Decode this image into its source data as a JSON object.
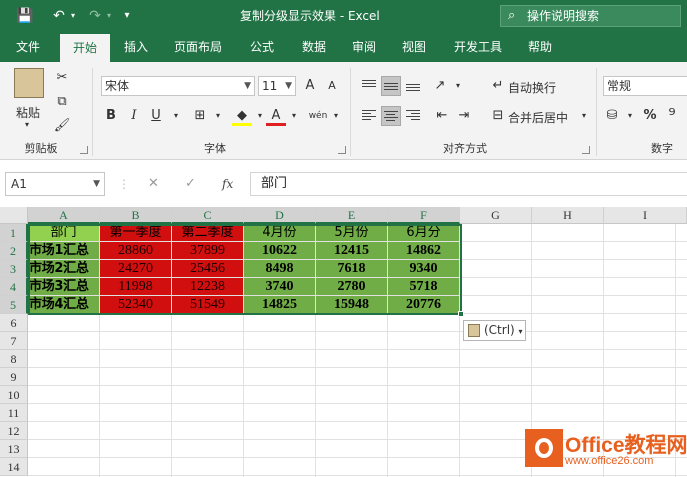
{
  "titlebar": {
    "title": "复制分级显示效果  -  Excel",
    "tell_me": "操作说明搜索"
  },
  "tabs": [
    "文件",
    "开始",
    "插入",
    "页面布局",
    "公式",
    "数据",
    "审阅",
    "视图",
    "开发工具",
    "帮助"
  ],
  "active_tab": "开始",
  "ribbon": {
    "clipboard": {
      "paste": "粘贴",
      "label": "剪贴板"
    },
    "font": {
      "name": "宋体",
      "size": "11",
      "bold": "B",
      "italic": "I",
      "underline": "U",
      "grow": "A",
      "shrink": "A",
      "color_letter": "A",
      "wen": "wén",
      "label": "字体"
    },
    "alignment": {
      "wrap": "自动换行",
      "merge": "合并后居中",
      "label": "对齐方式"
    },
    "number": {
      "format": "常规",
      "percent": "%",
      "label": "数字"
    }
  },
  "formula_bar": {
    "name_box": "A1",
    "fx": "fx",
    "content": "部门"
  },
  "grid": {
    "columns": [
      "A",
      "B",
      "C",
      "D",
      "E",
      "F",
      "G",
      "H",
      "I"
    ],
    "rows": [
      "1",
      "2",
      "3",
      "4",
      "5",
      "6",
      "7",
      "8",
      "9",
      "10",
      "11",
      "12",
      "13",
      "14"
    ],
    "data": [
      [
        "部门",
        "第一季度",
        "第二季度",
        "4月份",
        "5月份",
        "6月分"
      ],
      [
        "市场1汇总",
        "28860",
        "37899",
        "10622",
        "12415",
        "14862"
      ],
      [
        "市场2汇总",
        "24270",
        "25456",
        "8498",
        "7618",
        "9340"
      ],
      [
        "市场3汇总",
        "11998",
        "12238",
        "3740",
        "2780",
        "5718"
      ],
      [
        "市场4汇总",
        "52340",
        "51549",
        "14825",
        "15948",
        "20776"
      ]
    ],
    "fill_colors": {
      "green": "#70ad47",
      "red": "#d20f0f"
    }
  },
  "paste_options": {
    "label": "(Ctrl)"
  },
  "watermark": {
    "brand": "Office教程网",
    "url": "www.office26.com"
  },
  "colors": {
    "accent": "#217346"
  }
}
